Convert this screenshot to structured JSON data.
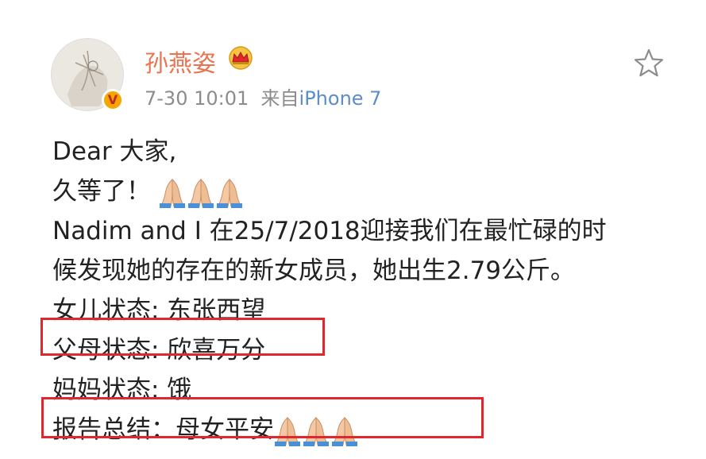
{
  "post": {
    "username": "孙燕姿",
    "timestamp": "7-30 10:01",
    "source_prefix": "来自",
    "source_device": "iPhone 7",
    "verified_badge": "V",
    "lines": [
      "Dear 大家,",
      "久等了！",
      "Nadim and I 在25/7/2018迎接我们在最忙碌的时",
      "候发现她的存在的新女成员，她出生2.79公斤。",
      "女儿状态: 东张西望",
      "父母状态: 欣喜万分",
      "妈妈状态: 饿",
      "报告总结：母女平安"
    ],
    "icons": {
      "favorite": "star-icon",
      "badge": "crown-icon",
      "emoji": "folded-hands-icon"
    },
    "colors": {
      "username": "#eb7350",
      "meta": "#8c8c8c",
      "source": "#5d8cc7",
      "highlight_border": "#e0272d",
      "verified": "#f7a500"
    }
  }
}
